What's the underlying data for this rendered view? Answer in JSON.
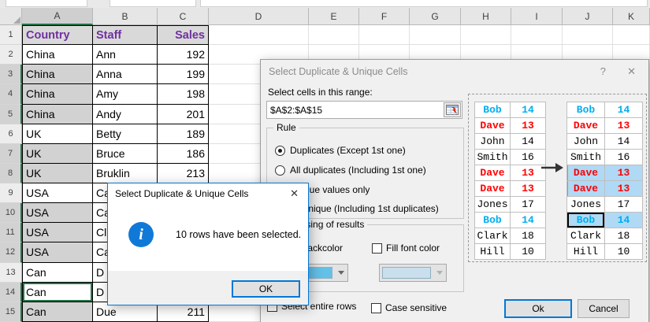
{
  "colors": {
    "accent_blue": "#0078D7",
    "excel_green": "#217346",
    "header_purple": "#7030A0",
    "back_fill_swatch": "#63C1E8",
    "font_fill_swatch": "#CADFEC",
    "preview_blue": "#00AEEF",
    "preview_red": "#FF0000",
    "highlight_blue": "#AFD9F5",
    "info_icon_blue": "#1079D8"
  },
  "spreadsheet": {
    "column_headers": [
      "A",
      "B",
      "C",
      "D",
      "E",
      "F",
      "G",
      "H",
      "I",
      "J",
      "K"
    ],
    "selected_column": "A",
    "rows": [
      {
        "n": "1",
        "a": "Country",
        "b": "Staff",
        "c": "Sales",
        "header": true
      },
      {
        "n": "2",
        "a": "China",
        "b": "Ann",
        "c": "192"
      },
      {
        "n": "3",
        "a": "China",
        "b": "Anna",
        "c": "199",
        "selected": true
      },
      {
        "n": "4",
        "a": "China",
        "b": "Amy",
        "c": "198",
        "selected": true
      },
      {
        "n": "5",
        "a": "China",
        "b": "Andy",
        "c": "201",
        "selected": true
      },
      {
        "n": "6",
        "a": "UK",
        "b": "Betty",
        "c": "189"
      },
      {
        "n": "7",
        "a": "UK",
        "b": "Bruce",
        "c": "186",
        "selected": true
      },
      {
        "n": "8",
        "a": "UK",
        "b": "Bruklin",
        "c": "213",
        "selected": true
      },
      {
        "n": "9",
        "a": "USA",
        "b": "Ca",
        "c": ""
      },
      {
        "n": "10",
        "a": "USA",
        "b": "Ca",
        "c": "",
        "selected": true
      },
      {
        "n": "11",
        "a": "USA",
        "b": "Cl",
        "c": "",
        "selected": true
      },
      {
        "n": "12",
        "a": "USA",
        "b": "Ca",
        "c": "",
        "selected": true
      },
      {
        "n": "13",
        "a": "Can",
        "b": "D",
        "c": ""
      },
      {
        "n": "14",
        "a": "Can",
        "b": "D",
        "c": "",
        "active": true
      },
      {
        "n": "15",
        "a": "Can",
        "b": "Due",
        "c": "211",
        "selected": true
      }
    ]
  },
  "dialog": {
    "title": "Select Duplicate & Unique Cells",
    "help_glyph": "?",
    "close_glyph": "✕",
    "range_label": "Select cells in this range:",
    "range_value": "$A$2:$A$15",
    "range_picker_icon": "grid-red-arrow",
    "rule_group": {
      "label": "Rule",
      "options": [
        {
          "label": "Duplicates (Except 1st one)",
          "selected": true
        },
        {
          "label": "All duplicates (Including 1st one)",
          "selected": false
        },
        {
          "label": "Unique values only",
          "selected": false
        },
        {
          "label": "All unique (Including 1st duplicates)",
          "selected": false
        }
      ]
    },
    "processing_group": {
      "label": "Processing of results",
      "fill_backcolor": {
        "label": "Fill backcolor",
        "checked": true
      },
      "fill_font_color": {
        "label": "Fill font color",
        "checked": false
      }
    },
    "select_entire_rows": {
      "label": "Select entire rows",
      "checked": false
    },
    "case_sensitive": {
      "label": "Case sensitive",
      "checked": false
    },
    "ok_label": "Ok",
    "cancel_label": "Cancel"
  },
  "preview": {
    "rows": [
      {
        "name": "Bob",
        "value": "14",
        "style": "blue",
        "dup": false,
        "active": false
      },
      {
        "name": "Dave",
        "value": "13",
        "style": "red",
        "dup": false,
        "active": false
      },
      {
        "name": "John",
        "value": "14",
        "style": "plain",
        "dup": false,
        "active": false
      },
      {
        "name": "Smith",
        "value": "16",
        "style": "plain",
        "dup": false,
        "active": false
      },
      {
        "name": "Dave",
        "value": "13",
        "style": "red",
        "dup": true,
        "active": false
      },
      {
        "name": "Dave",
        "value": "13",
        "style": "red",
        "dup": true,
        "active": false
      },
      {
        "name": "Jones",
        "value": "17",
        "style": "plain",
        "dup": false,
        "active": false
      },
      {
        "name": "Bob",
        "value": "14",
        "style": "blue",
        "dup": true,
        "active": true
      },
      {
        "name": "Clark",
        "value": "18",
        "style": "plain",
        "dup": false,
        "active": false
      },
      {
        "name": "Hill",
        "value": "10",
        "style": "plain",
        "dup": false,
        "active": false
      }
    ]
  },
  "msgbox": {
    "title": "Select Duplicate & Unique Cells",
    "close_glyph": "✕",
    "message": "10 rows have been selected.",
    "ok_label": "OK"
  }
}
